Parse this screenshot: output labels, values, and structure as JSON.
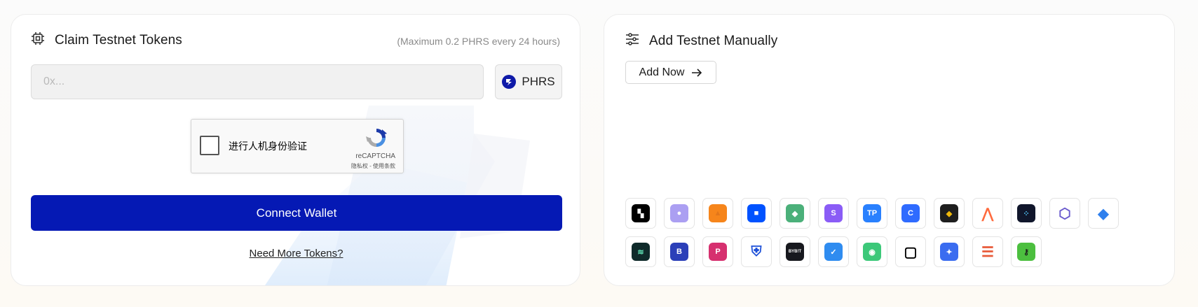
{
  "claim_card": {
    "title": "Claim Testnet Tokens",
    "hint": "(Maximum 0.2 PHRS every 24 hours)",
    "address_input": {
      "placeholder": "0x...",
      "value": ""
    },
    "token": {
      "symbol": "PHRS",
      "icon": "phrs-token-icon"
    },
    "captcha": {
      "label": "进行人机身份验证",
      "brand": "reCAPTCHA",
      "links": "隐私权 - 使用条款"
    },
    "connect_label": "Connect Wallet",
    "more_tokens_label": "Need More Tokens?"
  },
  "manual_card": {
    "title": "Add Testnet Manually",
    "add_now_label": "Add Now"
  },
  "wallets": [
    {
      "icon": "okx-wallet-icon",
      "bg": "#000000",
      "glyph": "▚",
      "fg": "#ffffff"
    },
    {
      "icon": "phantom-wallet-icon",
      "bg": "#ab9ff2",
      "glyph": "●",
      "fg": "#ffffff"
    },
    {
      "icon": "metamask-fox-icon",
      "bg": "#f6851b",
      "glyph": "▲",
      "fg": "#e2761b"
    },
    {
      "icon": "coinbase-wallet-icon",
      "bg": "#0052ff",
      "glyph": "■",
      "fg": "#ffffff"
    },
    {
      "icon": "rainbow-diamond-wallet-icon",
      "bg": "#4bb07a",
      "glyph": "◆",
      "fg": "#ffffff"
    },
    {
      "icon": "s-gradient-wallet-icon",
      "bg": "#8a5cf6",
      "glyph": "S",
      "fg": "#ffffff"
    },
    {
      "icon": "tokenpocket-wallet-icon",
      "bg": "#2980fe",
      "glyph": "TP",
      "fg": "#ffffff"
    },
    {
      "icon": "c-circle-wallet-icon",
      "bg": "#2f6bff",
      "glyph": "C",
      "fg": "#ffffff"
    },
    {
      "icon": "binance-wallet-icon",
      "bg": "#1e1e1e",
      "glyph": "◆",
      "fg": "#f0b90b"
    },
    {
      "icon": "a-peak-wallet-icon",
      "bg": "#ffffff",
      "glyph": "⋀",
      "fg": "#ff6a3d"
    },
    {
      "icon": "dot-grid-wallet-icon",
      "bg": "#10162b",
      "glyph": "⁘",
      "fg": "#4fc3f7"
    },
    {
      "icon": "hexagon-wallet-icon",
      "bg": "#ffffff",
      "glyph": "⬡",
      "fg": "#6a5acd"
    },
    {
      "icon": "trust-gem-wallet-icon",
      "bg": "#ffffff",
      "glyph": "◆",
      "fg": "#2f80ed"
    },
    {
      "icon": "waves-wallet-icon",
      "bg": "#0f2a2a",
      "glyph": "≋",
      "fg": "#5fe0b4"
    },
    {
      "icon": "b-blue-wallet-icon",
      "bg": "#2b3fb8",
      "glyph": "B",
      "fg": "#ffffff"
    },
    {
      "icon": "p-gradient-wallet-icon",
      "bg": "#d6306f",
      "glyph": "P",
      "fg": "#ffffff"
    },
    {
      "icon": "shield-wallet-icon",
      "bg": "#ffffff",
      "glyph": "⛨",
      "fg": "#1c4fd8"
    },
    {
      "icon": "bybit-wallet-icon",
      "bg": "#17181e",
      "glyph": "BYB!T",
      "fg": "#ffffff"
    },
    {
      "icon": "bird-wallet-icon",
      "bg": "#2f8cf0",
      "glyph": "✓",
      "fg": "#ffffff"
    },
    {
      "icon": "green-ring-wallet-icon",
      "bg": "#3cc879",
      "glyph": "◉",
      "fg": "#ffffff"
    },
    {
      "icon": "square-ring-wallet-icon",
      "bg": "#ffffff",
      "glyph": "▢",
      "fg": "#000000"
    },
    {
      "icon": "sparkle-wallet-icon",
      "bg": "#3a6cf0",
      "glyph": "✦",
      "fg": "#ffffff"
    },
    {
      "icon": "stripes-wallet-icon",
      "bg": "#ffffff",
      "glyph": "☰",
      "fg": "#e85b3a"
    },
    {
      "icon": "green-key-wallet-icon",
      "bg": "#4cbf3f",
      "glyph": "⚷",
      "fg": "#1a1a1a"
    }
  ]
}
